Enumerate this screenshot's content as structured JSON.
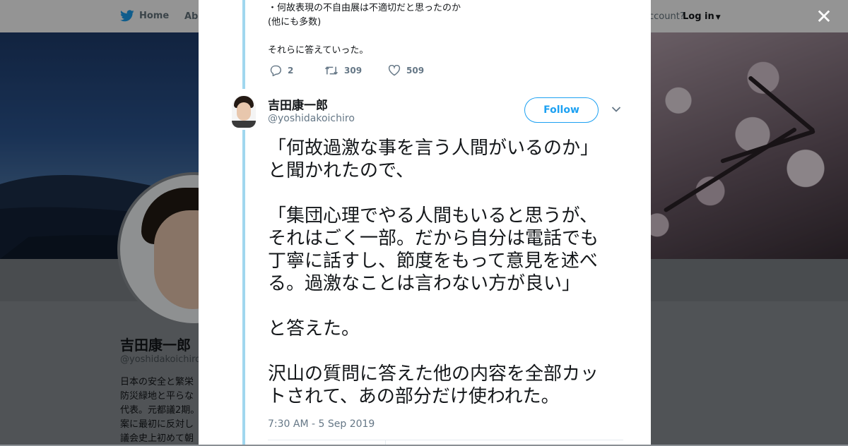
{
  "topbar": {
    "home_label": "Home",
    "about_label": "Abo",
    "account_question": "ccount?",
    "login_label": "Log in"
  },
  "profile": {
    "name": "吉田康一郎",
    "handle": "@yoshidakoichiro",
    "bio_lines": [
      "日本の安全と繁栄",
      "防災緑地と平らな",
      "代表。元都議2期。",
      "案に最初に反対し",
      "議会史上初めて朝"
    ]
  },
  "modal": {
    "prev_tweet_lines": [
      "・何故表現の不自由展は不適切だと思ったのか",
      "(他にも多数)",
      "",
      "それらに答えていった。"
    ],
    "prev_actions": {
      "replies": "2",
      "retweets": "309",
      "likes": "509"
    },
    "author": {
      "name": "吉田康一郎",
      "handle": "@yoshidakoichiro"
    },
    "follow_label": "Follow",
    "tweet_lines": [
      "「何故過激な事を言う人間がいるのか」",
      "と聞かれたので、",
      "",
      "「集団心理でやる人間もいると思うが、",
      "それはごく一部。だから自分は電話でも",
      "丁寧に話すし、節度をもって意見を述べ",
      "る。過激なことは言わない方が良い」",
      "",
      "と答えた。",
      "",
      "沢山の質問に答えた他の内容を全部カッ",
      "トされて、あの部分だけ使われた。"
    ],
    "timestamp": "7:30 AM - 5 Sep 2019"
  },
  "colors": {
    "twitter_blue": "#1da1f2",
    "thread_line": "#a0d7ef",
    "muted_text": "#657786"
  },
  "icons": [
    "twitter-bird-icon",
    "close-icon",
    "reply-icon",
    "retweet-icon",
    "like-icon",
    "chevron-down-icon"
  ]
}
